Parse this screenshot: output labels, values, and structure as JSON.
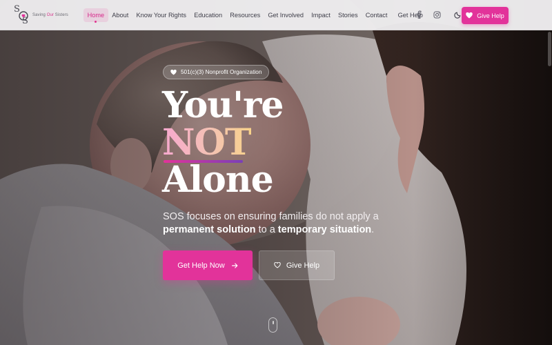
{
  "brand": {
    "logo_letters": "SOS",
    "name_part1": "Saving ",
    "name_highlight": "Our",
    "name_part2": " Sisters",
    "accent_color": "#e2339a"
  },
  "nav": {
    "items": [
      {
        "label": "Home",
        "active": true
      },
      {
        "label": "About"
      },
      {
        "label": "Know Your Rights"
      },
      {
        "label": "Education"
      },
      {
        "label": "Resources"
      },
      {
        "label": "Get Involved"
      },
      {
        "label": "Impact"
      },
      {
        "label": "Stories"
      },
      {
        "label": "Contact"
      },
      {
        "label": "Get Help"
      }
    ],
    "icons": [
      "facebook-icon",
      "instagram-icon",
      "moon-icon"
    ],
    "give_help_label": "Give Help"
  },
  "hero": {
    "badge": "501(c)(3) Nonprofit Organization",
    "headline_line1": "You're",
    "headline_highlight": "NOT",
    "headline_line3": "Alone",
    "tagline_part1": "SOS focuses on ensuring families do not apply a ",
    "tagline_bold1": "permanent solution",
    "tagline_part2": " to a ",
    "tagline_bold2": "temporary situation",
    "tagline_part3": ".",
    "primary_cta": "Get Help Now",
    "secondary_cta": "Give Help"
  }
}
